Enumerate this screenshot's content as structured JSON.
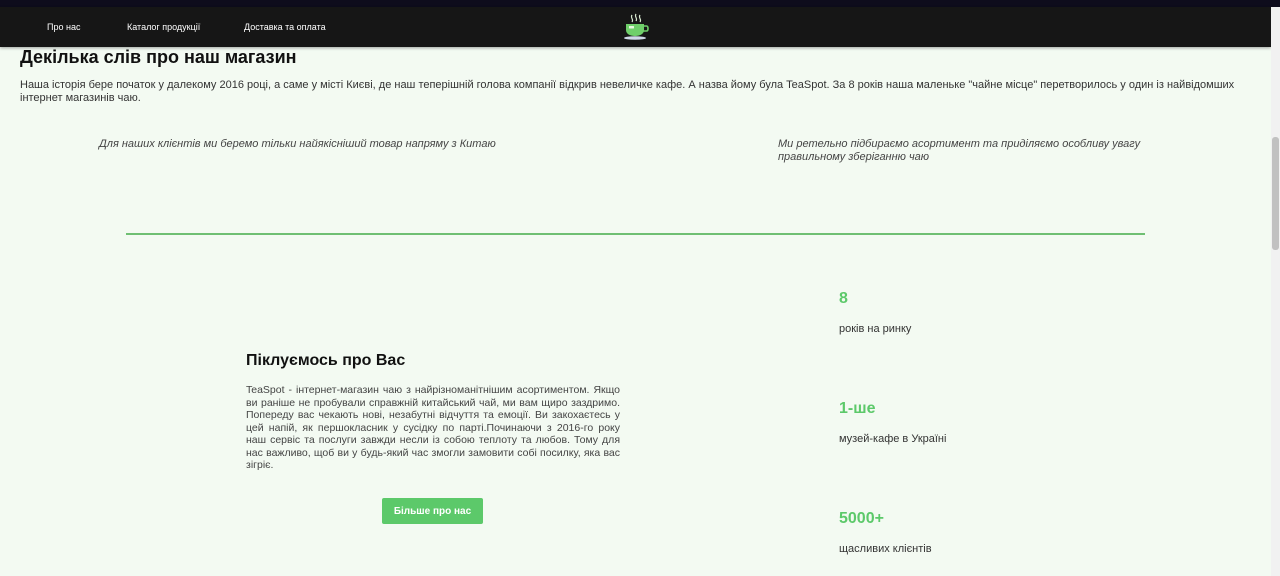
{
  "nav": {
    "items": [
      {
        "label": "Про нас"
      },
      {
        "label": "Каталог продукції"
      },
      {
        "label": "Доставка та оплата"
      }
    ],
    "logo_icon": "tea-cup-icon"
  },
  "about": {
    "title": "Декілька слів про наш магазин",
    "text": "Наша історія бере початок у далекому 2016 році, а саме у місті Києві, де наш теперішній голова компанії відкрив невеличке кафе. А назва йому була TeaSpot. За 8 років наша маленьке \"чайне місце\" перетворилось у один із найвідомших інтернет магазинів чаю.",
    "features": [
      {
        "text": "Для наших клієнтів ми беремо тільки найякісніший товар напряму з Китаю"
      },
      {
        "text": "Ми ретельно підбираємо асортимент та приділяємо особливу увагу правильному зберіганню чаю"
      }
    ]
  },
  "care": {
    "title": "Піклуємось про Вас",
    "text": "TeaSpot - інтернет-магазин чаю з найрізноманітнішим асортиментом. Якщо ви раніше не пробували справжній китайський чай, ми вам щиро заздримо. Попереду вас чекають нові, незабутні відчуття та емоції. Ви закохаєтесь у цей напій, як першокласник у сусідку по парті.Починаючи з 2016-го року наш сервіс та послуги завжди несли із собою теплоту та любов. Тому для нас важливо, щоб ви у будь-який час змогли замовити собі посилку, яка вас зігріє.",
    "button_label": "Більше про нас"
  },
  "stats": [
    {
      "value": "8",
      "label": "років на ринку"
    },
    {
      "value": "1-ше",
      "label": "музей-кафе в Україні"
    },
    {
      "value": "5000+",
      "label": "щасливих клієнтів"
    }
  ],
  "colors": {
    "accent": "#5cc96a",
    "navbar": "#161616",
    "background": "#f3faf2",
    "divider": "#6fbf73"
  }
}
